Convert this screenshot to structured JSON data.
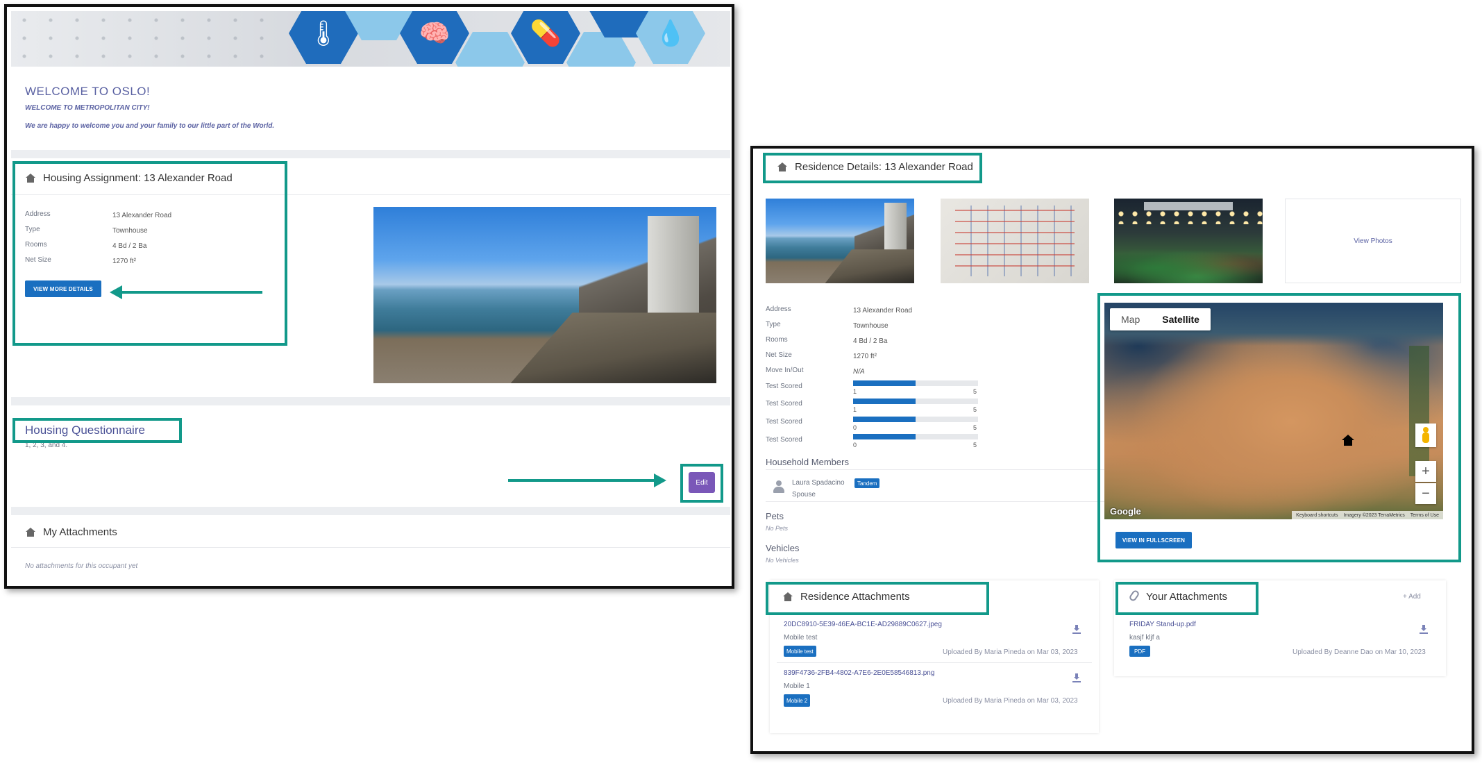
{
  "left_panel": {
    "welcome": {
      "title": "WELCOME TO OSLO!",
      "subtitle": "WELCOME TO METROPOLITAN CITY!",
      "message": "We are happy to welcome you and your family to our little part of the World."
    },
    "housing_assignment": {
      "title": "Housing Assignment: 13 Alexander Road",
      "fields": [
        {
          "label": "Address",
          "value": "13 Alexander Road"
        },
        {
          "label": "Type",
          "value": "Townhouse"
        },
        {
          "label": "Rooms",
          "value": "4 Bd / 2 Ba"
        },
        {
          "label": "Net Size",
          "value": "1270 ft²"
        }
      ],
      "view_more_label": "VIEW MORE DETAILS"
    },
    "questionnaire": {
      "title": "Housing Questionnaire",
      "text": "1, 2, 3, and 4.",
      "edit_label": "Edit"
    },
    "attachments": {
      "title": "My Attachments",
      "empty_text": "No attachments for this occupant yet"
    }
  },
  "right_panel": {
    "title": "Residence Details: 13 Alexander Road",
    "view_photos_label": "View Photos",
    "fields": [
      {
        "label": "Address",
        "value": "13 Alexander Road"
      },
      {
        "label": "Type",
        "value": "Townhouse"
      },
      {
        "label": "Rooms",
        "value": "4 Bd / 2 Ba"
      },
      {
        "label": "Net Size",
        "value": "1270 ft²"
      },
      {
        "label": "Move In/Out",
        "value": "N/A"
      }
    ],
    "scores": [
      {
        "label": "Test Scored",
        "min": "1",
        "max": "5",
        "fill": 0.5
      },
      {
        "label": "Test Scored",
        "min": "1",
        "max": "5",
        "fill": 0.5
      },
      {
        "label": "Test Scored",
        "min": "0",
        "max": "5",
        "fill": 0.5
      },
      {
        "label": "Test Scored",
        "min": "0",
        "max": "5",
        "fill": 0.5
      }
    ],
    "household": {
      "title": "Household Members",
      "member_name": "Laura Spadacino",
      "member_badge": "Tandem",
      "member_role": "Spouse"
    },
    "pets": {
      "title": "Pets",
      "value": "No Pets"
    },
    "vehicles": {
      "title": "Vehicles",
      "value": "No Vehicles"
    },
    "map": {
      "map_label": "Map",
      "satellite_label": "Satellite",
      "zoom_in": "+",
      "zoom_out": "−",
      "google": "Google",
      "footer": [
        "Keyboard shortcuts",
        "Imagery ©2023 TerraMetrics",
        "Terms of Use"
      ],
      "fullscreen_label": "VIEW IN FULLSCREEN"
    },
    "residence_attachments": {
      "title": "Residence Attachments",
      "items": [
        {
          "file": "20DC8910-5E39-46EA-BC1E-AD29889C0627.jpeg",
          "desc": "Mobile test",
          "tag": "Mobile test",
          "uploaded": "Uploaded By Maria Pineda on Mar 03, 2023"
        },
        {
          "file": "839F4736-2FB4-4802-A7E6-2E0E58546813.png",
          "desc": "Mobile 1",
          "tag": "Mobile 2",
          "uploaded": "Uploaded By Maria Pineda on Mar 03, 2023"
        }
      ]
    },
    "your_attachments": {
      "title": "Your Attachments",
      "add_label": "+ Add",
      "items": [
        {
          "file": "FRIDAY Stand-up.pdf",
          "desc": "kasjf kljf a",
          "tag": "PDF",
          "uploaded": "Uploaded By Deanne Dao on Mar 10, 2023"
        }
      ]
    }
  },
  "icons": [
    "house-icon",
    "user-avatar-icon",
    "paperclip-icon",
    "download-icon",
    "thermometer-icon",
    "brain-icon",
    "pills-icon",
    "drops-icon",
    "flask-icon",
    "home-marker-icon",
    "pegman-icon"
  ],
  "colors": {
    "teal_highlight": "#12998a",
    "primary_blue": "#1a6fc0",
    "purple_button": "#7a57b8",
    "heading_indigo": "#5a61a2"
  }
}
